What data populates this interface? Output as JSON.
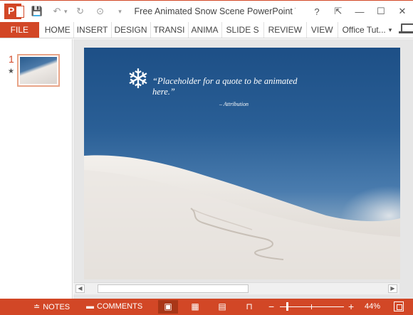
{
  "window": {
    "title": "Free Animated Snow Scene PowerPoint Te...",
    "help": "?",
    "restore_ribbon": "⇱",
    "minimize": "—",
    "maximize": "☐",
    "close": "✕"
  },
  "qat": {
    "save_icon": "💾",
    "undo_icon": "↶",
    "undo_caret": "▾",
    "redo_icon": "↻",
    "present_icon": "⊙",
    "customize_icon": "▾"
  },
  "ribbon": {
    "file": "FILE",
    "tabs": [
      "HOME",
      "INSERT",
      "DESIGN",
      "TRANSI",
      "ANIMA",
      "SLIDE S",
      "REVIEW",
      "VIEW"
    ],
    "account": "Office Tut...",
    "account_caret": "▾"
  },
  "thumbnails": {
    "slide_number": "1",
    "star": "★"
  },
  "slide": {
    "snowflake": "❄",
    "quote": "“Placeholder for a quote to be animated here.”",
    "attribution": "– Attribution"
  },
  "scrollbar": {
    "left_arrow": "◀",
    "right_arrow": "▶"
  },
  "status": {
    "notes_icon": "≐",
    "notes": "NOTES",
    "comments_icon": "▬",
    "comments": "COMMENTS",
    "normal_view_icon": "▣",
    "sorter_view_icon": "▦",
    "reading_view_icon": "▤",
    "slideshow_icon": "⊓",
    "zoom_minus": "−",
    "zoom_plus": "+",
    "zoom": "44%",
    "zoom_level": 0.44
  }
}
